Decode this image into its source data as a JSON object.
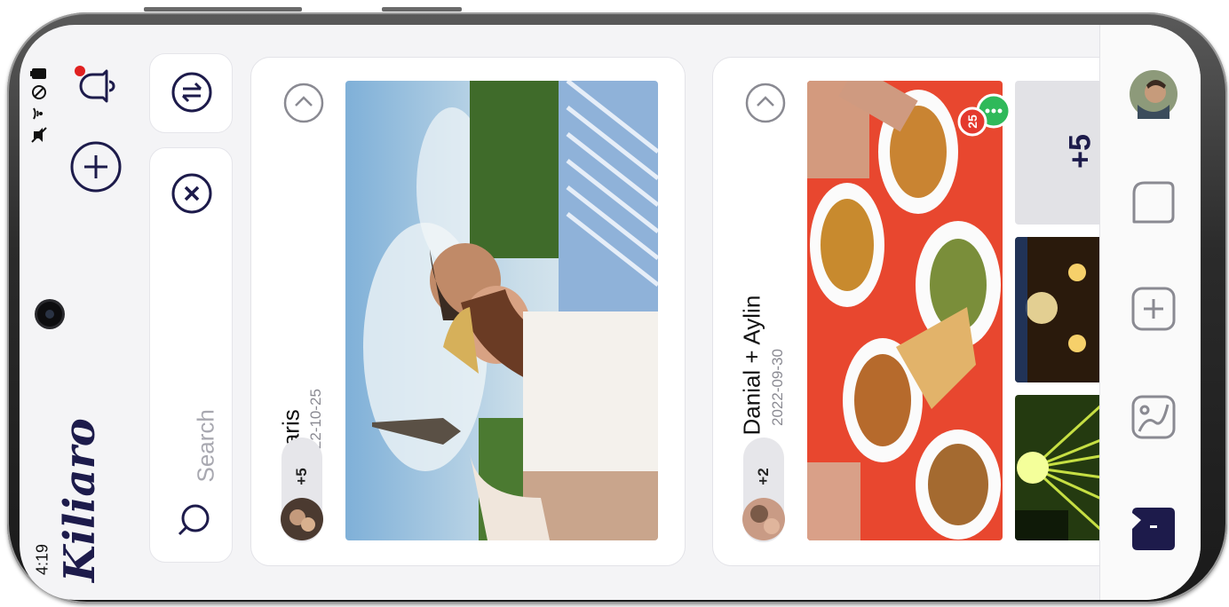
{
  "status_bar": {
    "time": "4:19",
    "icons": [
      "battery-icon",
      "do-not-disturb-icon",
      "wifi-icon",
      "mute-icon"
    ]
  },
  "app": {
    "logo": "Kiliaro",
    "brand_color": "#1d1b4b",
    "notification_dot_color": "#e02020"
  },
  "header": {
    "add_icon": "plus-circle-icon",
    "notification_icon": "bell-icon"
  },
  "search": {
    "placeholder": "Search",
    "clear_icon": "close-circle-icon",
    "filter_icon": "swap-circle-icon"
  },
  "albums": [
    {
      "title": "Paris",
      "date": "2022-10-25",
      "extra_members": "+5"
    },
    {
      "title": "Danial + Aylin",
      "date": "2022-09-30",
      "extra_members": "+2",
      "comment_count": "25",
      "more_photos": "+5"
    }
  ],
  "right_nav": {
    "items": [
      "profile-avatar",
      "albums-icon",
      "add-album-icon",
      "gallery-icon",
      "account-tab-icon"
    ]
  }
}
